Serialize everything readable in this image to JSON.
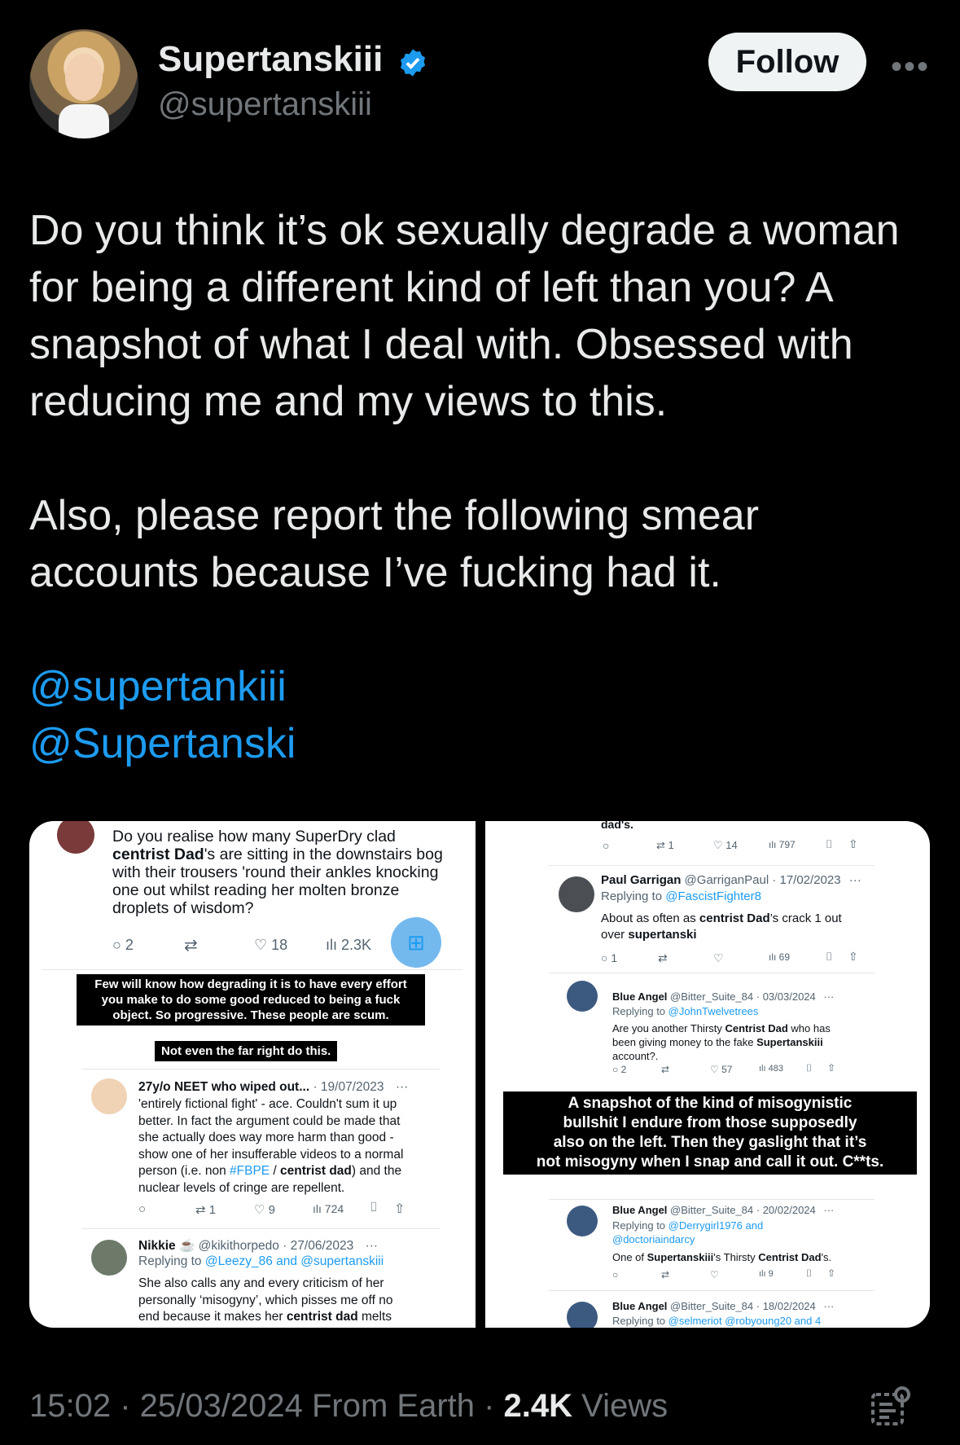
{
  "header": {
    "display_name": "Supertanskiii",
    "handle": "@supertanskiii",
    "follow_label": "Follow",
    "more_label": "•••"
  },
  "tweet": {
    "paragraph1": "Do you think it’s ok sexually degrade a woman for being a different kind of left than you? A snapshot of what I deal with. Obsessed with reducing me and my views to this.",
    "paragraph2": "Also, please report the following smear accounts because I’ve fucking had it.",
    "mention1": "@supertankiii",
    "mention2": "@Supertanski"
  },
  "image_left": {
    "post1": {
      "line1": "Do you realise how many SuperDry clad",
      "line2_bold": "centrist Dad",
      "line2_rest": "'s are sitting in the downstairs bog",
      "line3": "with their trousers 'round their ankles knocking",
      "line4": "one out whilst reading her molten bronze",
      "line5": "droplets of wisdom?",
      "replies": "2",
      "likes": "18",
      "views": "2.3K"
    },
    "caption1_line1": "Few will know how degrading it is to have every effort",
    "caption1_line2": "you make to do some good reduced to being a fuck",
    "caption1_line3": "object. So progressive. These people are scum.",
    "caption2": "Not even the far right do this.",
    "post2": {
      "name": "27y/o NEET who wiped out...",
      "date": "· 19/07/2023",
      "more": "···",
      "line1": "'entirely fictional fight' - ace. Couldn't sum it up",
      "line2": "better. In fact the argument could be made that",
      "line3": "she actually does way more harm than good -",
      "line4": "show one of her insufferable videos to a normal",
      "line5_a": "person (i.e. non ",
      "line5_tag": "#FBPE",
      "line5_b": " / ",
      "line5_bold": "centrist dad",
      "line5_c": ") and the",
      "line6": "nuclear levels of cringe are repellent.",
      "retweets": "1",
      "likes": "9",
      "views": "724"
    },
    "post3": {
      "name": "Nikkie ☕",
      "handle_date": "@kikithorpedo · 27/06/2023",
      "more": "···",
      "replying_label": "Replying to ",
      "replying_to": "@Leezy_86 and @supertanskiii",
      "line1": "She also calls any and every criticism of her",
      "line2": "personally ‘misogyny’, which pisses me off no",
      "line3_a": "end because it makes her ",
      "line3_bold": "centrist dad",
      "line3_b": " melts"
    }
  },
  "image_right": {
    "top_fragment": "dad's.",
    "top_retweets": "1",
    "top_likes": "14",
    "top_views": "797",
    "post1": {
      "name": "Paul Garrigan",
      "handle_date": "@GarriganPaul · 17/02/2023",
      "more": "···",
      "replying_label": "Replying to ",
      "replying_to": "@FascistFighter8",
      "line1_a": "About as often as ",
      "line1_bold": "centrist Dad",
      "line1_b": "’s crack 1 out",
      "line2_a": "over ",
      "line2_bold": "supertanski",
      "replies": "1",
      "views": "69"
    },
    "post2": {
      "name": "Blue Angel",
      "handle_date": "@Bitter_Suite_84 · 03/03/2024",
      "more": "···",
      "replying_label": "Replying to ",
      "replying_to": "@JohnTwelvetrees",
      "line1_a": "Are you another Thirsty ",
      "line1_bold": "Centrist Dad",
      "line1_b": " who has",
      "line2_a": "been giving money to the fake ",
      "line2_bold": "Supertanskiii",
      "line3": "account?.",
      "replies": "2",
      "likes": "57",
      "views": "483"
    },
    "caption_line1": "A snapshot of the kind of misogynistic",
    "caption_line2": "bullshit I endure from those supposedly",
    "caption_line3": "also on the left. Then they gaslight that it’s",
    "caption_line4": "not misogyny when I snap and call it out. C**ts.",
    "post3": {
      "name": "Blue Angel",
      "handle_date": "@Bitter_Suite_84 · 20/02/2024",
      "more": "···",
      "replying_label": "Replying to ",
      "replying_to_1": "@Derrygirl1976 and",
      "replying_to_2": "@doctoriaindarcy",
      "line1_a": "One of ",
      "line1_bold": "Supertanskiii",
      "line1_b": "'s Thirsty ",
      "line1_bold2": "Centrist Dad",
      "line1_c": "'s.",
      "views": "9"
    },
    "post4": {
      "name": "Blue Angel",
      "handle_date": "@Bitter_Suite_84 · 18/02/2024",
      "more": "···",
      "replying_label": "Replying to ",
      "replying_to": "@selmeriot @robyoung20 and 4"
    }
  },
  "footer": {
    "time_date": "15:02 · 25/03/2024 From Earth · ",
    "views_count": "2.4K",
    "views_label": " Views"
  },
  "colors": {
    "background": "#000000",
    "text": "#e7e9ea",
    "muted": "#71767b",
    "link": "#1d9bf0",
    "verified": "#1d9bf0"
  }
}
